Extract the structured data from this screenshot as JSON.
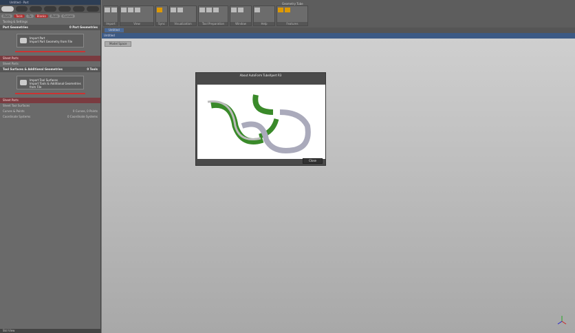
{
  "left": {
    "title": "Untitled - Part",
    "filters": [
      "Parts",
      "Tools",
      "Tx",
      "Blanks",
      "Pads",
      "Curves"
    ],
    "tooling": "Tooling & Settings",
    "part_geo": {
      "label": "Part Geometries",
      "count": "0 Part Geometries",
      "import_title": "Import Part",
      "import_sub": "Import Part Geometry from File"
    },
    "sheet_parts": "Sheet Parts",
    "sheet_sub": "Sheet Parts",
    "tool_geo": {
      "label": "Tool Surfaces & Additional Geometries",
      "count": "0 Tools",
      "import_title": "Import Tool Surfaces",
      "import_sub": "Import Tools & Additional Geometries from File"
    },
    "sheet_parts2": "Sheet Parts",
    "sheet_sub2": "Sheet Tool Surfaces",
    "curves": {
      "label": "Curves & Points",
      "count": "0 Curves, 0 Points"
    },
    "coords": {
      "label": "Coordinate Systems",
      "count": "0 Coordinate Systems"
    },
    "bottom": "Std   View"
  },
  "ribbon": {
    "groups": [
      "Import",
      "View",
      "Sync",
      "Visualization",
      "Tool Preparation",
      "Window",
      "Help",
      "Features"
    ],
    "tabs": [
      "Geometry",
      "Tube"
    ]
  },
  "doc_tab": "Untitled",
  "viewport_title": "Untitled",
  "view_button": "Model Space",
  "dialog": {
    "title": "About AutoForm TubeXpert R3",
    "close": "Close"
  }
}
